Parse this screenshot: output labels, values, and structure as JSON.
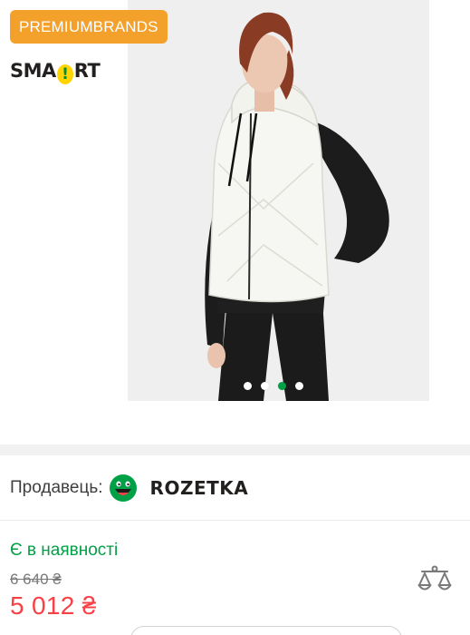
{
  "gallery": {
    "badges": {
      "premium_label": "PREMIUMBRANDS",
      "smart_label_pre": "SMA",
      "smart_label_mark": "!",
      "smart_label_post": "RT"
    },
    "slides_total": 4,
    "active_slide": 3
  },
  "seller": {
    "label": "Продавець:",
    "name": "ROZETKA"
  },
  "availability": "Є в наявності",
  "price": {
    "old": "6 640 ₴",
    "current": "5 012 ₴"
  },
  "colors": {
    "accent_orange": "#f4a12b",
    "available_green": "#00a046",
    "price_red": "#f84147",
    "smart_yellow": "#ffd400"
  },
  "icons": [
    "rozetka-logo-icon",
    "compare-scales-icon"
  ]
}
